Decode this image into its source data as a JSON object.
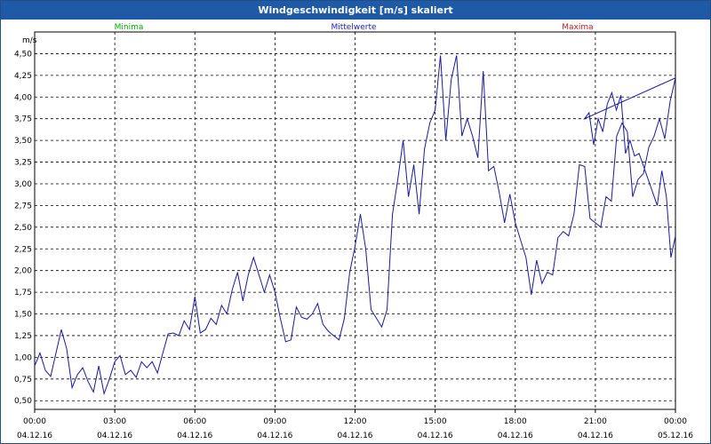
{
  "window": {
    "title": "Windgeschwindigkeit [m/s] skaliert"
  },
  "colors": {
    "titlebar": "#1f5aa6",
    "grid": "#000000",
    "series_line": "#1a1aa0",
    "legend_min": "#00b000",
    "legend_mean": "#2020c0",
    "legend_max": "#c02020"
  },
  "chart_data": {
    "type": "line",
    "ylabel": "m/s",
    "ylim": [
      0.4,
      4.75
    ],
    "yticks": [
      "0,50",
      "0,75",
      "1,00",
      "1,25",
      "1,50",
      "1,75",
      "2,00",
      "2,25",
      "2,50",
      "2,75",
      "3,00",
      "3,25",
      "3,50",
      "3,75",
      "4,00",
      "4,25",
      "4,50"
    ],
    "ytick_values": [
      0.5,
      0.75,
      1.0,
      1.25,
      1.5,
      1.75,
      2.0,
      2.25,
      2.5,
      2.75,
      3.0,
      3.25,
      3.5,
      3.75,
      4.0,
      4.25,
      4.5
    ],
    "xlim_hours": [
      0,
      24
    ],
    "xticks": [
      {
        "time": "00:00",
        "date": "04.12.16"
      },
      {
        "time": "03:00",
        "date": "04.12.16"
      },
      {
        "time": "06:00",
        "date": "04.12.16"
      },
      {
        "time": "09:00",
        "date": "04.12.16"
      },
      {
        "time": "12:00",
        "date": "04.12.16"
      },
      {
        "time": "15:00",
        "date": "04.12.16"
      },
      {
        "time": "18:00",
        "date": "04.12.16"
      },
      {
        "time": "21:00",
        "date": "04.12.16"
      },
      {
        "time": "00:00",
        "date": "05.12.16"
      }
    ],
    "grid": true,
    "legend_position": "top",
    "legend": [
      {
        "label": "Minima",
        "color_key": "legend_min"
      },
      {
        "label": "Mittelwerte",
        "color_key": "legend_mean"
      },
      {
        "label": "Maxima",
        "color_key": "legend_max"
      }
    ],
    "series": [
      {
        "x_hours": [
          0,
          0.2,
          0.4,
          0.6,
          0.8,
          1.0,
          1.2,
          1.4,
          1.6,
          1.8,
          2.0,
          2.2,
          2.4,
          2.6,
          2.8,
          3.0,
          3.2,
          3.4,
          3.6,
          3.8,
          4.0,
          4.2,
          4.4,
          4.6,
          4.8,
          5.0,
          5.2,
          5.4,
          5.6,
          5.8,
          6.0,
          6.2,
          6.4,
          6.6,
          6.8,
          7.0,
          7.2,
          7.4,
          7.6,
          7.8,
          8.0,
          8.2,
          8.4,
          8.6,
          8.8,
          9.0,
          9.2,
          9.4,
          9.6,
          9.8,
          10.0,
          10.2,
          10.4,
          10.6,
          10.8,
          11.0,
          11.2,
          11.4,
          11.6,
          11.8,
          12.0,
          12.2,
          12.4,
          12.6,
          12.8,
          13.0,
          13.2,
          13.4,
          13.6,
          13.8,
          14.0,
          14.2,
          14.4,
          14.6,
          14.8,
          15.0,
          15.2,
          15.4,
          15.6,
          15.8,
          16.0,
          16.2,
          16.4,
          16.6,
          16.8,
          17.0,
          17.2,
          17.4,
          17.6,
          17.8,
          18.0,
          18.2,
          18.4,
          18.6,
          18.8,
          19.0,
          19.2,
          19.4,
          19.6,
          19.8,
          20.0,
          20.2,
          20.4,
          20.6,
          20.8,
          21.0,
          21.2,
          21.4,
          21.6,
          21.8,
          22.0,
          22.2,
          22.4,
          22.6,
          22.8,
          23.0,
          23.2,
          23.4,
          23.6,
          23.8,
          24.0
        ],
        "values": [
          0.9,
          1.05,
          0.85,
          0.78,
          1.05,
          1.32,
          1.1,
          0.65,
          0.8,
          0.88,
          0.72,
          0.6,
          0.9,
          0.58,
          0.75,
          0.95,
          1.02,
          0.8,
          0.85,
          0.77,
          0.95,
          0.88,
          0.95,
          0.82,
          1.05,
          1.27,
          1.28,
          1.25,
          1.42,
          1.32,
          1.7,
          1.28,
          1.32,
          1.45,
          1.38,
          1.6,
          1.5,
          1.78,
          1.98,
          1.65,
          1.95,
          2.15,
          1.95,
          1.75,
          1.95,
          1.75,
          1.45,
          1.18,
          1.2,
          1.58,
          1.46,
          1.44,
          1.5,
          1.62,
          1.38,
          1.3,
          1.25,
          1.2,
          1.45,
          1.98,
          2.28,
          2.65,
          2.25,
          1.55,
          1.45,
          1.35,
          1.55,
          2.65,
          3.05,
          3.5,
          2.85,
          3.22,
          2.65,
          3.4,
          3.7,
          3.85,
          4.48,
          3.5,
          4.2,
          4.48,
          3.55,
          3.75,
          3.55,
          3.3,
          4.3,
          3.15,
          3.2,
          2.9,
          2.55,
          2.88,
          2.55,
          2.35,
          2.15,
          1.72,
          2.12,
          1.85,
          1.98,
          1.95,
          2.38,
          2.45,
          2.4,
          2.65,
          3.22,
          3.2,
          2.6,
          2.55,
          2.5,
          2.85,
          2.8,
          3.55,
          3.7,
          3.6,
          2.85,
          3.05,
          3.12,
          3.42,
          3.55,
          3.75,
          3.52,
          3.95,
          4.22,
          3.75,
          3.82,
          3.45,
          3.75,
          3.6,
          3.92,
          4.05,
          3.85,
          4.02,
          3.35,
          3.5,
          3.32,
          3.35,
          3.2,
          3.05,
          2.9,
          2.75,
          3.15,
          2.85,
          2.15,
          2.4
        ]
      }
    ]
  }
}
